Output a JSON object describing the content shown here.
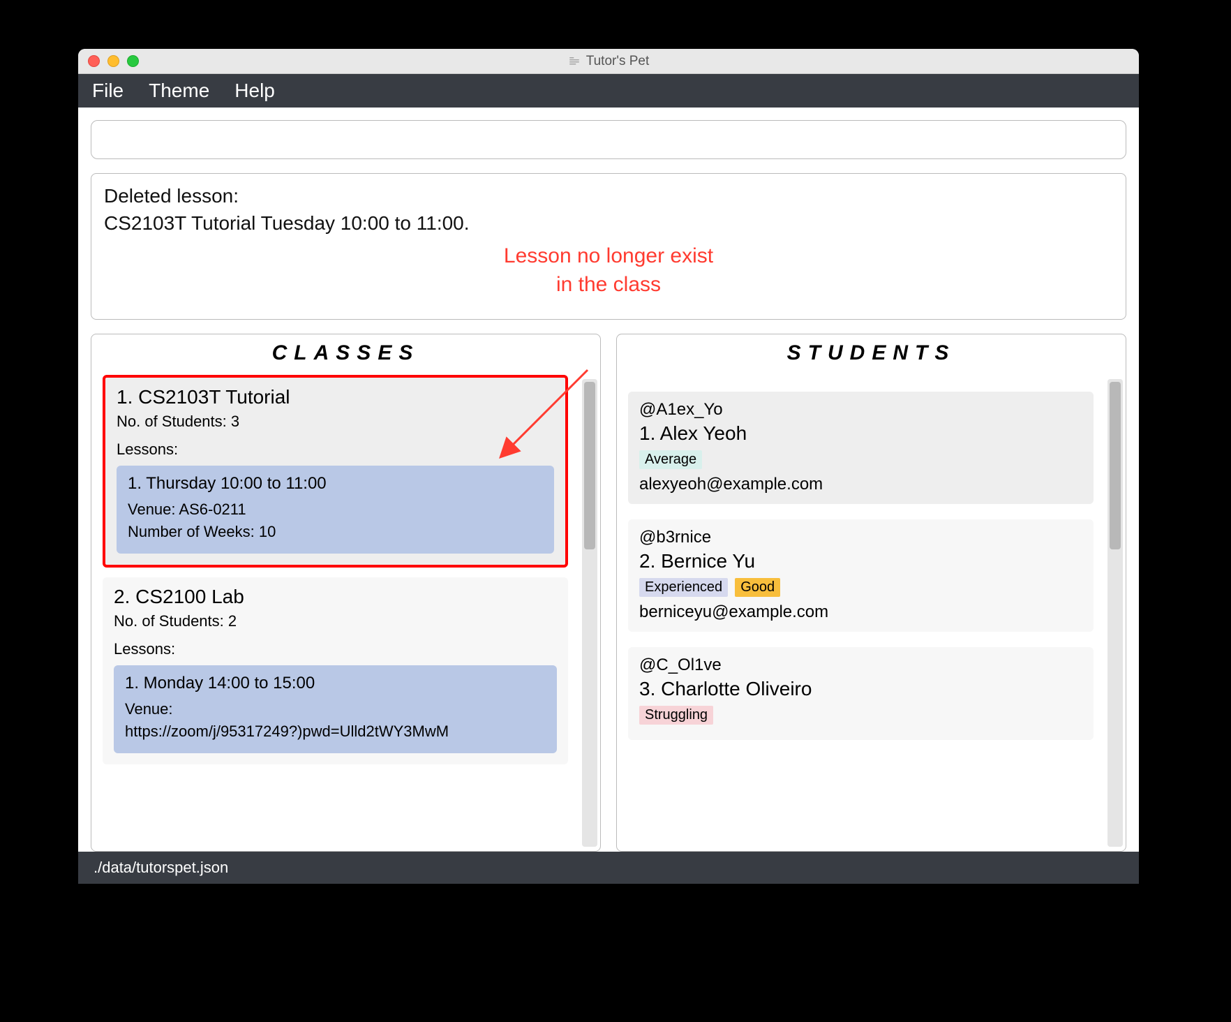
{
  "window": {
    "title": "Tutor's Pet"
  },
  "menu": {
    "file": "File",
    "theme": "Theme",
    "help": "Help"
  },
  "message": {
    "line1": "Deleted lesson:",
    "line2": "CS2103T Tutorial Tuesday 10:00 to 11:00."
  },
  "annotation": {
    "line1": "Lesson no longer exist",
    "line2": "in the class"
  },
  "panels": {
    "classes": {
      "header": "CLASSES",
      "items": [
        {
          "title": "1.  CS2103T Tutorial",
          "students": "No. of Students:  3",
          "lessons_label": "Lessons:",
          "lesson": {
            "time": "1. Thursday 10:00 to 11:00",
            "venue": "Venue: AS6-0211",
            "weeks": "Number of Weeks: 10"
          }
        },
        {
          "title": "2.  CS2100 Lab",
          "students": "No. of Students:  2",
          "lessons_label": "Lessons:",
          "lesson": {
            "time": "1. Monday 14:00 to 15:00",
            "venue": "Venue:",
            "link": "https://zoom/j/95317249?)pwd=Ulld2tWY3MwM"
          }
        }
      ]
    },
    "students": {
      "header": "STUDENTS",
      "items": [
        {
          "handle": "@A1ex_Yo",
          "name": "1.  Alex Yeoh",
          "tags": [
            {
              "text": "Average",
              "cls": "tag-average"
            }
          ],
          "email": "alexyeoh@example.com"
        },
        {
          "handle": "@b3rnice",
          "name": "2.  Bernice Yu",
          "tags": [
            {
              "text": "Experienced",
              "cls": "tag-experienced"
            },
            {
              "text": "Good",
              "cls": "tag-good"
            }
          ],
          "email": "berniceyu@example.com"
        },
        {
          "handle": "@C_Ol1ve",
          "name": "3.  Charlotte Oliveiro",
          "tags": [
            {
              "text": "Struggling",
              "cls": "tag-struggling"
            }
          ],
          "email": ""
        }
      ]
    }
  },
  "statusbar": {
    "path": "./data/tutorspet.json"
  }
}
